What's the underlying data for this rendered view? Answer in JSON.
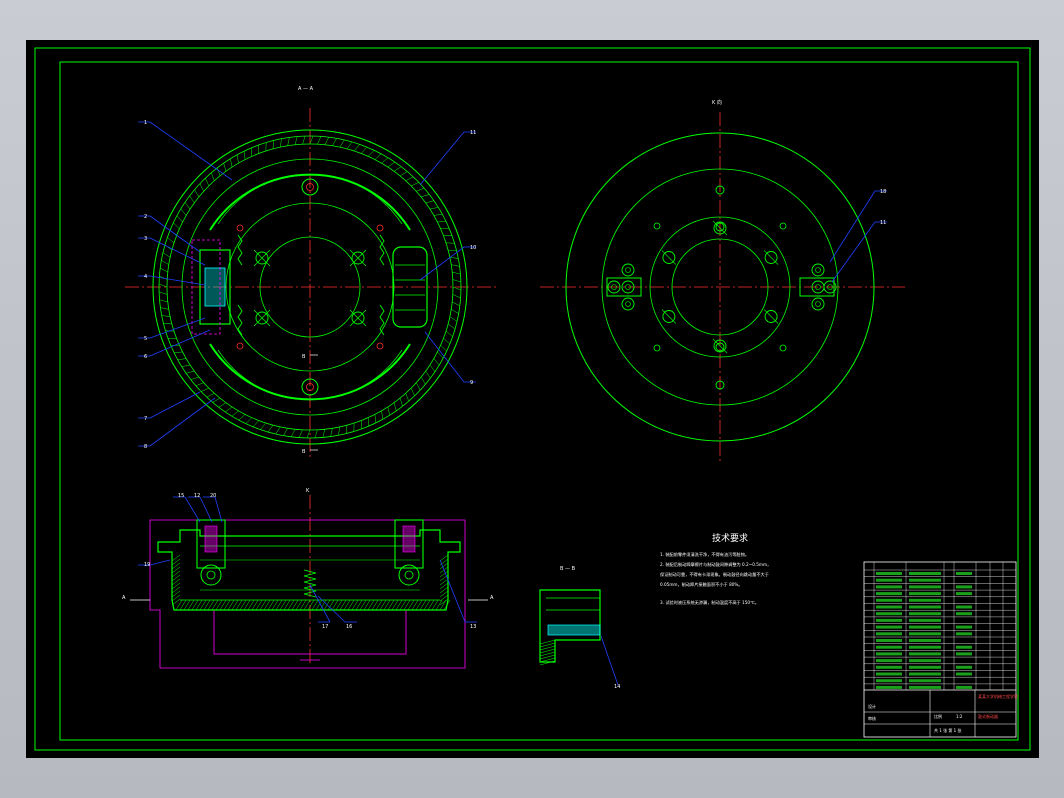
{
  "drawing": {
    "section_label_top": "A — A",
    "view_label_right": "K 向",
    "section_label_bottom_left": "K",
    "section_label_detail": "B — B",
    "section_arrow_a_left": "A",
    "section_arrow_a_right": "A",
    "section_arrow_b_top": "B",
    "section_arrow_b_bottom": "B"
  },
  "part_numbers": {
    "front": [
      "1",
      "2",
      "3",
      "4",
      "5",
      "6",
      "7",
      "8",
      "9",
      "10",
      "11"
    ],
    "right": [
      "18",
      "11"
    ],
    "section": [
      "15",
      "12",
      "20",
      "13",
      "17",
      "16",
      "19"
    ],
    "detail": [
      "14"
    ]
  },
  "tech_requirements": {
    "heading": "技术要求",
    "items": [
      "1. 装配前零件须清洗干净，不得有油污等脏物。",
      "2. 装配后制动蹄摩擦片与制动鼓间隙调整为 0.2~0.5mm，",
      "   保证制动可靠，不得有卡滞现象。制动鼓径向跳动量不大于",
      "   0.05mm，制动蹄片接触面积不小于 80%。",
      "3. 试验时液压系统无渗漏，制动温度不高于 150℃。"
    ]
  },
  "title_block": {
    "drawing_name": "鼓式制动器",
    "school": "某某大学机械工程学院",
    "sheet_info": "共 1 张  第 1 张",
    "scale_label": "比例",
    "scale": "1:2",
    "designer_label": "设计",
    "check_label": "审核"
  },
  "colors": {
    "background": "#000000",
    "frame": "#00ff00",
    "outline": "#00ff00",
    "centerline": "#ff3030",
    "leader": "#1e40ff",
    "hidden": "#ff00ff",
    "detail": "#00ffff",
    "text": "#ffffff",
    "hatch": "#00ff00"
  }
}
